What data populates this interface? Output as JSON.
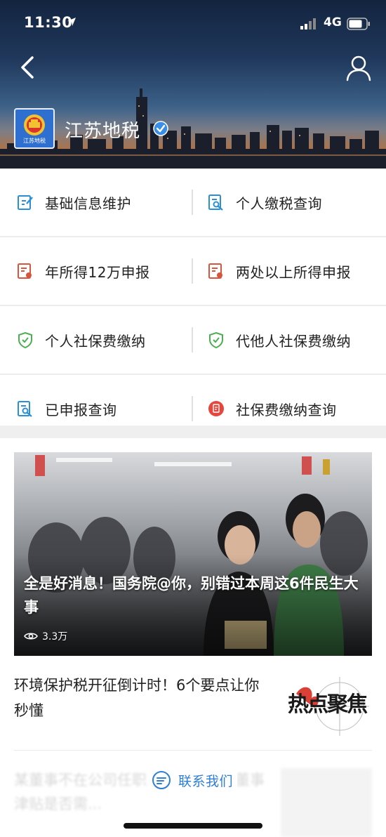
{
  "status_bar": {
    "time": "11:30",
    "network": "4G"
  },
  "header": {
    "account_name": "江苏地税",
    "logo_text": "江苏地税"
  },
  "menu": {
    "rows": [
      [
        {
          "label": "基础信息维护",
          "icon": "edit-icon",
          "color": "#2a8fd6"
        },
        {
          "label": "个人缴税查询",
          "icon": "search-doc-icon",
          "color": "#2a8fd6"
        }
      ],
      [
        {
          "label": "年所得12万申报",
          "icon": "doc-icon",
          "color": "#d9543f"
        },
        {
          "label": "两处以上所得申报",
          "icon": "doc-icon",
          "color": "#d9543f"
        }
      ],
      [
        {
          "label": "个人社保费缴纳",
          "icon": "shield-icon",
          "color": "#4caf50"
        },
        {
          "label": "代他人社保费缴纳",
          "icon": "shield-icon",
          "color": "#4caf50"
        }
      ],
      [
        {
          "label": "已申报查询",
          "icon": "search-doc-icon",
          "color": "#2a8fd6"
        },
        {
          "label": "社保费缴纳查询",
          "icon": "circle-doc-icon",
          "color": "#e8453c"
        }
      ]
    ]
  },
  "articles": {
    "featured": {
      "title": "全是好消息！国务院@你，别错过本周这6件民生大事",
      "views": "3.3万"
    },
    "second": {
      "title": "环境保护税开征倒计时！6个要点让你秒懂",
      "thumb_text": "热点聚焦"
    },
    "faded": {
      "title": "某董事不在公司任职，公司支付的董事津贴是否需..."
    }
  },
  "contact": {
    "label": "联系我们"
  },
  "colors": {
    "accent_blue": "#2f7fd4",
    "verified_blue": "#3a8ee6"
  }
}
